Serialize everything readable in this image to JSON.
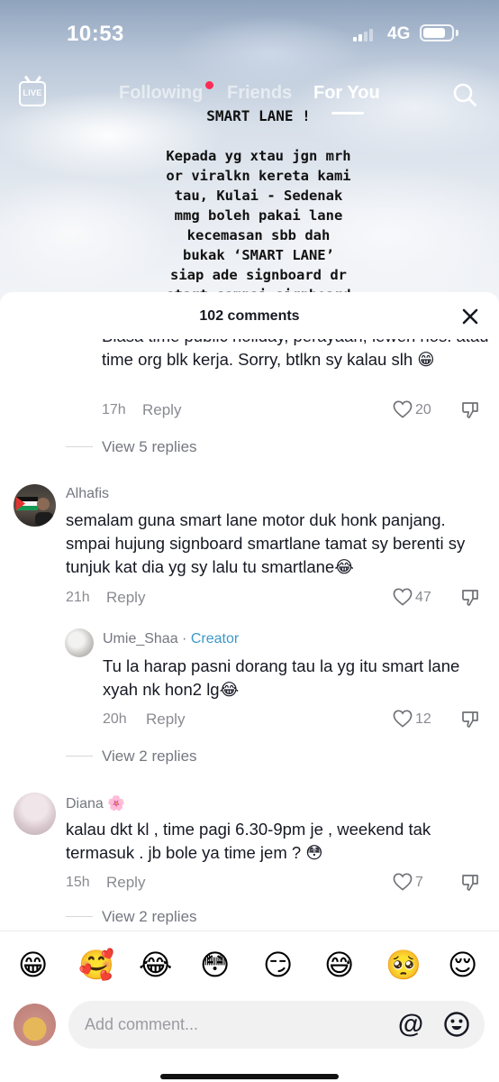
{
  "status_bar": {
    "time": "10:53",
    "network": "4G",
    "battery_level": 0.8
  },
  "top_nav": {
    "tabs": [
      {
        "label": "Following",
        "active": false
      },
      {
        "label": "Friends",
        "active": false
      },
      {
        "label": "For You",
        "active": true
      }
    ]
  },
  "video": {
    "caption_title": "SMART LANE !",
    "caption_lines": [
      "Kepada yg xtau jgn mrh",
      "or viralkn kereta kami",
      "tau, Kulai - Sedenak",
      "mmg boleh pakai lane",
      "kecemasan sbb dah",
      "bukak ‘SMART LANE’",
      "siap ade signboard dr",
      "start sampai signboard"
    ]
  },
  "comments_sheet": {
    "count_label": "102 comments",
    "partial_comment": {
      "text": "Biasa time public holiday, perayaan, lewen hos. atau time org blk kerja. Sorry, btlkn sy kalau slh 😁",
      "time": "17h",
      "reply_label": "Reply",
      "likes": "20",
      "view_replies": "View 5 replies"
    },
    "comments": [
      {
        "author": "Alhafis",
        "text": "semalam guna smart lane motor duk honk panjang. smpai hujung signboard smartlane tamat sy berenti sy tunjuk kat dia yg sy lalu tu smartlane😂",
        "time": "21h",
        "reply_label": "Reply",
        "likes": "47",
        "reply": {
          "author": "Umie_Shaa",
          "badge": "Creator",
          "separator": " · ",
          "text": "Tu la harap pasni dorang tau la yg itu smart lane xyah nk hon2 lg😂",
          "time": "20h",
          "reply_label": "Reply",
          "likes": "12"
        },
        "view_replies": "View 2 replies"
      },
      {
        "author": "Diana 🌸",
        "text": "kalau dkt kl , time pagi 6.30-9pm je , weekend tak termasuk . jb bole ya time jem ? 😳",
        "time": "15h",
        "reply_label": "Reply",
        "likes": "7",
        "view_replies": "View 2 replies"
      }
    ]
  },
  "emoji_bar": [
    "😁",
    "🥰",
    "😂",
    "😳",
    "😏",
    "😅",
    "🥺",
    "😌"
  ],
  "comment_input": {
    "placeholder": "Add comment..."
  },
  "colors": {
    "accent_red": "#fe2c55",
    "creator_blue": "#3c98c8",
    "text_primary": "#161823",
    "text_secondary": "#8a8b91"
  }
}
